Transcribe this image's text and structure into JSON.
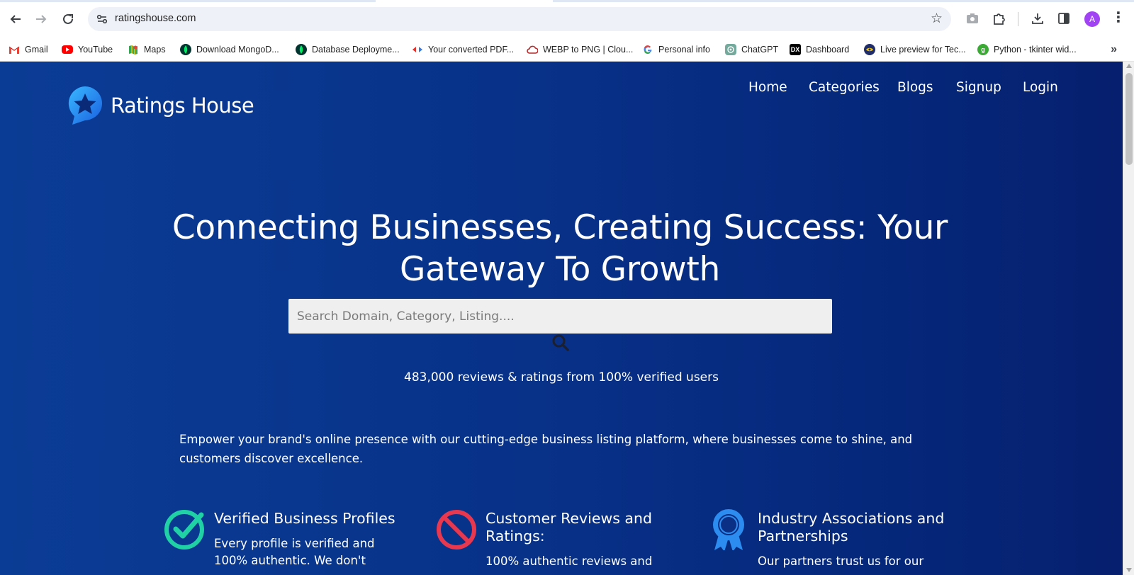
{
  "browser": {
    "url": "ratingshouse.com",
    "profile_initial": "A",
    "accent": "#a142f4",
    "bookmarks": [
      {
        "label": "Gmail",
        "icon": "gmail-icon",
        "color": "#ea4335"
      },
      {
        "label": "YouTube",
        "icon": "youtube-icon",
        "color": "#ff0000"
      },
      {
        "label": "Maps",
        "icon": "maps-icon",
        "color": "#34a853"
      },
      {
        "label": "Download MongoD...",
        "icon": "mongodb-icon",
        "color": "#023430"
      },
      {
        "label": "Database Deployme...",
        "icon": "mongodb-icon",
        "color": "#023430"
      },
      {
        "label": "Your converted PDF...",
        "icon": "pdf-converter-icon",
        "color": "#e5322d"
      },
      {
        "label": "WEBP to PNG | Clou...",
        "icon": "cloudconvert-icon",
        "color": "#b32b2b"
      },
      {
        "label": "Personal info",
        "icon": "google-icon",
        "color": "#4285f4"
      },
      {
        "label": "ChatGPT",
        "icon": "chatgpt-icon",
        "color": "#74aa9c"
      },
      {
        "label": "Dashboard",
        "icon": "devto-icon",
        "color": "#000000"
      },
      {
        "label": "Live preview for Tec...",
        "icon": "live-preview-icon",
        "color": "#1f2d6b"
      },
      {
        "label": "Python - tkinter wid...",
        "icon": "python-icon",
        "color": "#3aaa35"
      }
    ]
  },
  "site": {
    "logo_text": "Ratings House",
    "nav": [
      "Home",
      "Categories",
      "Blogs",
      "Signup",
      "Login"
    ],
    "hero_title": "Connecting Businesses, Creating Success: Your Gateway To Growth",
    "search_placeholder": "Search Domain, Category, Listing....",
    "stats": "483,000 reviews & ratings from 100% verified users",
    "intro": "Empower your brand's online presence with our cutting-edge business listing platform, where businesses come to shine, and customers discover excellence.",
    "features": [
      {
        "title": "Verified Business Profiles",
        "desc": "Every profile is verified and 100% authentic. We don't",
        "icon": "verified-check-icon",
        "color": "#1fd1a5"
      },
      {
        "title": "Customer Reviews and Ratings:",
        "desc": "100% authentic reviews and",
        "icon": "prohibited-icon",
        "color": "#e8384f"
      },
      {
        "title": "Industry Associations and Partnerships",
        "desc": "Our partners trust us for our",
        "icon": "award-ribbon-icon",
        "color": "#2d8cf0"
      }
    ]
  }
}
